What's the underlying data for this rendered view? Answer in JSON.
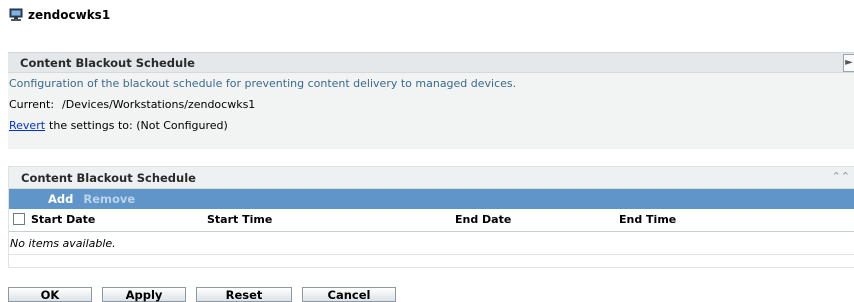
{
  "device_name": "zendocwks1",
  "info_panel": {
    "title": "Content Blackout Schedule",
    "description": "Configuration of the blackout schedule for preventing content delivery to managed devices.",
    "current_label": "Current:",
    "current_path": "/Devices/Workstations/zendocwks1",
    "revert_link": "Revert",
    "revert_text": "the settings to: (Not Configured)"
  },
  "schedule_panel": {
    "title": "Content Blackout Schedule",
    "toolbar": {
      "add": "Add",
      "remove": "Remove"
    },
    "columns": [
      "Start Date",
      "Start Time",
      "End Date",
      "End Time"
    ],
    "empty_message": "No items available."
  },
  "buttons": {
    "ok": "OK",
    "apply": "Apply",
    "reset": "Reset",
    "cancel": "Cancel"
  },
  "icons": {
    "title_icon": "computer-icon",
    "collapse": "collapse-icon",
    "double_chevron": "double-chevron-up-icon"
  }
}
